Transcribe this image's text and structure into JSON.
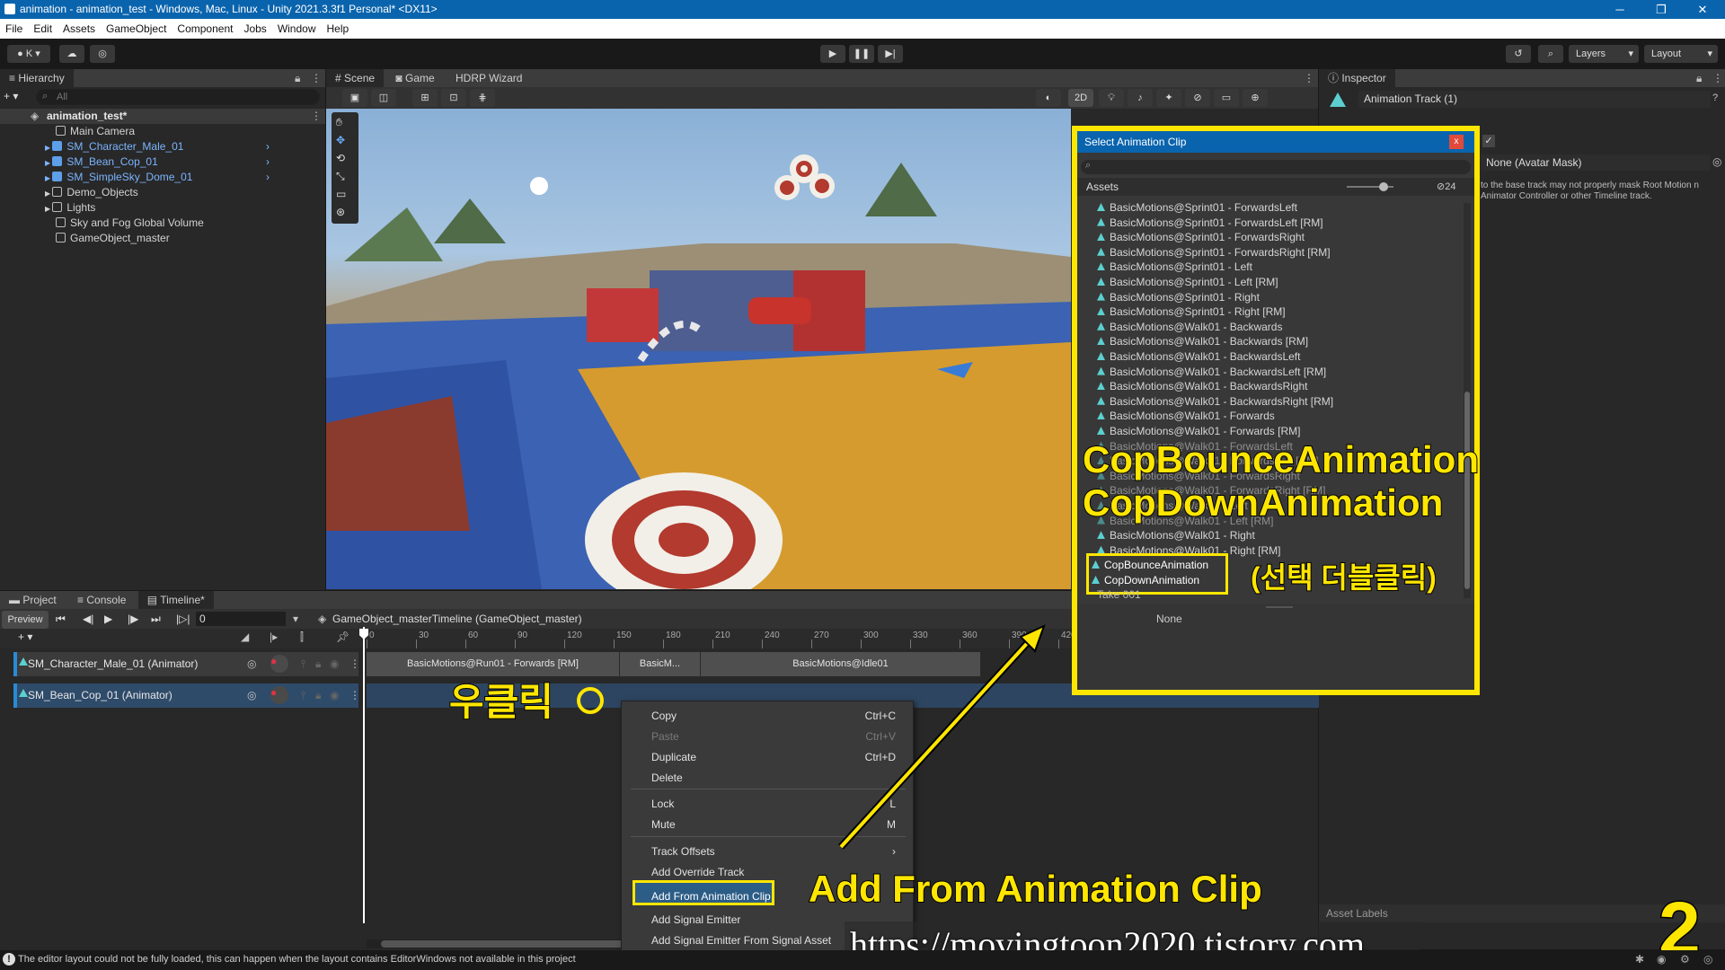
{
  "titlebar": {
    "title": "animation - animation_test - Windows, Mac, Linux - Unity 2021.3.3f1 Personal* <DX11>"
  },
  "menubar": {
    "items": [
      "File",
      "Edit",
      "Assets",
      "GameObject",
      "Component",
      "Jobs",
      "Window",
      "Help"
    ]
  },
  "toolbar": {
    "account": "K",
    "layers": "Layers",
    "layout": "Layout"
  },
  "hierarchy": {
    "tab": "Hierarchy",
    "search_placeholder": "All",
    "scene": "animation_test*",
    "items": [
      {
        "label": "Main Camera",
        "blue": false
      },
      {
        "label": "SM_Character_Male_01",
        "blue": true
      },
      {
        "label": "SM_Bean_Cop_01",
        "blue": true
      },
      {
        "label": "SM_SimpleSky_Dome_01",
        "blue": true
      },
      {
        "label": "Demo_Objects",
        "blue": false
      },
      {
        "label": "Lights",
        "blue": false
      },
      {
        "label": "Sky and Fog Global Volume",
        "blue": false
      },
      {
        "label": "GameObject_master",
        "blue": false
      }
    ]
  },
  "scene_tabs": {
    "scene": "Scene",
    "game": "Game",
    "hdrp": "HDRP Wizard",
    "mode2d": "2D"
  },
  "inspector": {
    "tab": "Inspector",
    "title": "Animation Track (1)",
    "avatar_mask": "None (Avatar Mask)",
    "hint": "to the base track may not properly mask Root Motion n Animator Controller or other Timeline track.",
    "asset_labels": "Asset Labels"
  },
  "dialog": {
    "title": "Select Animation Clip",
    "close": "x",
    "assets_label": "Assets",
    "count": "24",
    "none": "None",
    "clips": [
      "BasicMotions@Sprint01 - ForwardsLeft",
      "BasicMotions@Sprint01 - ForwardsLeft [RM]",
      "BasicMotions@Sprint01 - ForwardsRight",
      "BasicMotions@Sprint01 - ForwardsRight [RM]",
      "BasicMotions@Sprint01 - Left",
      "BasicMotions@Sprint01 - Left [RM]",
      "BasicMotions@Sprint01 - Right",
      "BasicMotions@Sprint01 - Right [RM]",
      "BasicMotions@Walk01 - Backwards",
      "BasicMotions@Walk01 - Backwards [RM]",
      "BasicMotions@Walk01 - BackwardsLeft",
      "BasicMotions@Walk01 - BackwardsLeft [RM]",
      "BasicMotions@Walk01 - BackwardsRight",
      "BasicMotions@Walk01 - BackwardsRight [RM]",
      "BasicMotions@Walk01 - Forwards",
      "BasicMotions@Walk01 - Forwards [RM]",
      "BasicMotions@Walk01 - ForwardsLeft",
      "BasicMotions@Walk01 - ForwardsLeft [RM]",
      "BasicMotions@Walk01 - ForwardsRight",
      "BasicMotions@Walk01 - ForwardsRight [RM]",
      "BasicMotions@Walk01 - Left",
      "BasicMotions@Walk01 - Left [RM]",
      "BasicMotions@Walk01 - Right",
      "BasicMotions@Walk01 - Right [RM]"
    ],
    "selected": [
      "CopBounceAnimation",
      "CopDownAnimation"
    ],
    "after": "Take 001"
  },
  "bottom_tabs": {
    "project": "Project",
    "console": "Console",
    "timeline": "Timeline*"
  },
  "timeline": {
    "preview": "Preview",
    "frame": "0",
    "asset": "GameObject_masterTimeline (GameObject_master)",
    "ticks": [
      "0",
      "30",
      "60",
      "90",
      "120",
      "150",
      "180",
      "210",
      "240",
      "270",
      "300",
      "330",
      "360",
      "390",
      "420"
    ],
    "tracks": [
      {
        "label": "SM_Character_Male_01 (Animator)"
      },
      {
        "label": "SM_Bean_Cop_01 (Animator)"
      }
    ],
    "clips": [
      "BasicMotions@Run01 - Forwards [RM]",
      "BasicM...",
      "BasicMotions@Idle01"
    ]
  },
  "context_menu": {
    "items": [
      {
        "label": "Copy",
        "shortcut": "Ctrl+C",
        "disabled": false
      },
      {
        "label": "Paste",
        "shortcut": "Ctrl+V",
        "disabled": true
      },
      {
        "label": "Duplicate",
        "shortcut": "Ctrl+D",
        "disabled": false
      },
      {
        "label": "Delete",
        "shortcut": "",
        "disabled": false
      },
      {
        "label": "Lock",
        "shortcut": "L",
        "disabled": false
      },
      {
        "label": "Mute",
        "shortcut": "M",
        "disabled": false
      },
      {
        "label": "Track Offsets",
        "shortcut": "›",
        "disabled": false
      },
      {
        "label": "Add Override Track",
        "shortcut": "",
        "disabled": false
      },
      {
        "label": "Add From Animation Clip",
        "shortcut": "",
        "disabled": false
      },
      {
        "label": "Add Signal Emitter",
        "shortcut": "",
        "disabled": false
      },
      {
        "label": "Add Signal Emitter From Signal Asset",
        "shortcut": "",
        "disabled": false
      }
    ]
  },
  "annotations": {
    "copbounce": "CopBounceAnimation",
    "copdown": "CopDownAnimation",
    "korean_select": "(선택 더블클릭)",
    "right_click": "우클릭",
    "add_from": "Add From Animation Clip",
    "page_number": "2",
    "url": "https://movingtoon2020.tistory.com"
  },
  "status": {
    "message": "The editor layout could not be fully loaded, this can happen when the layout contains EditorWindows not available in this project"
  },
  "colors": {
    "accent": "#ffe600",
    "title_blue": "#0a64ad",
    "selection": "#2c5d87"
  }
}
